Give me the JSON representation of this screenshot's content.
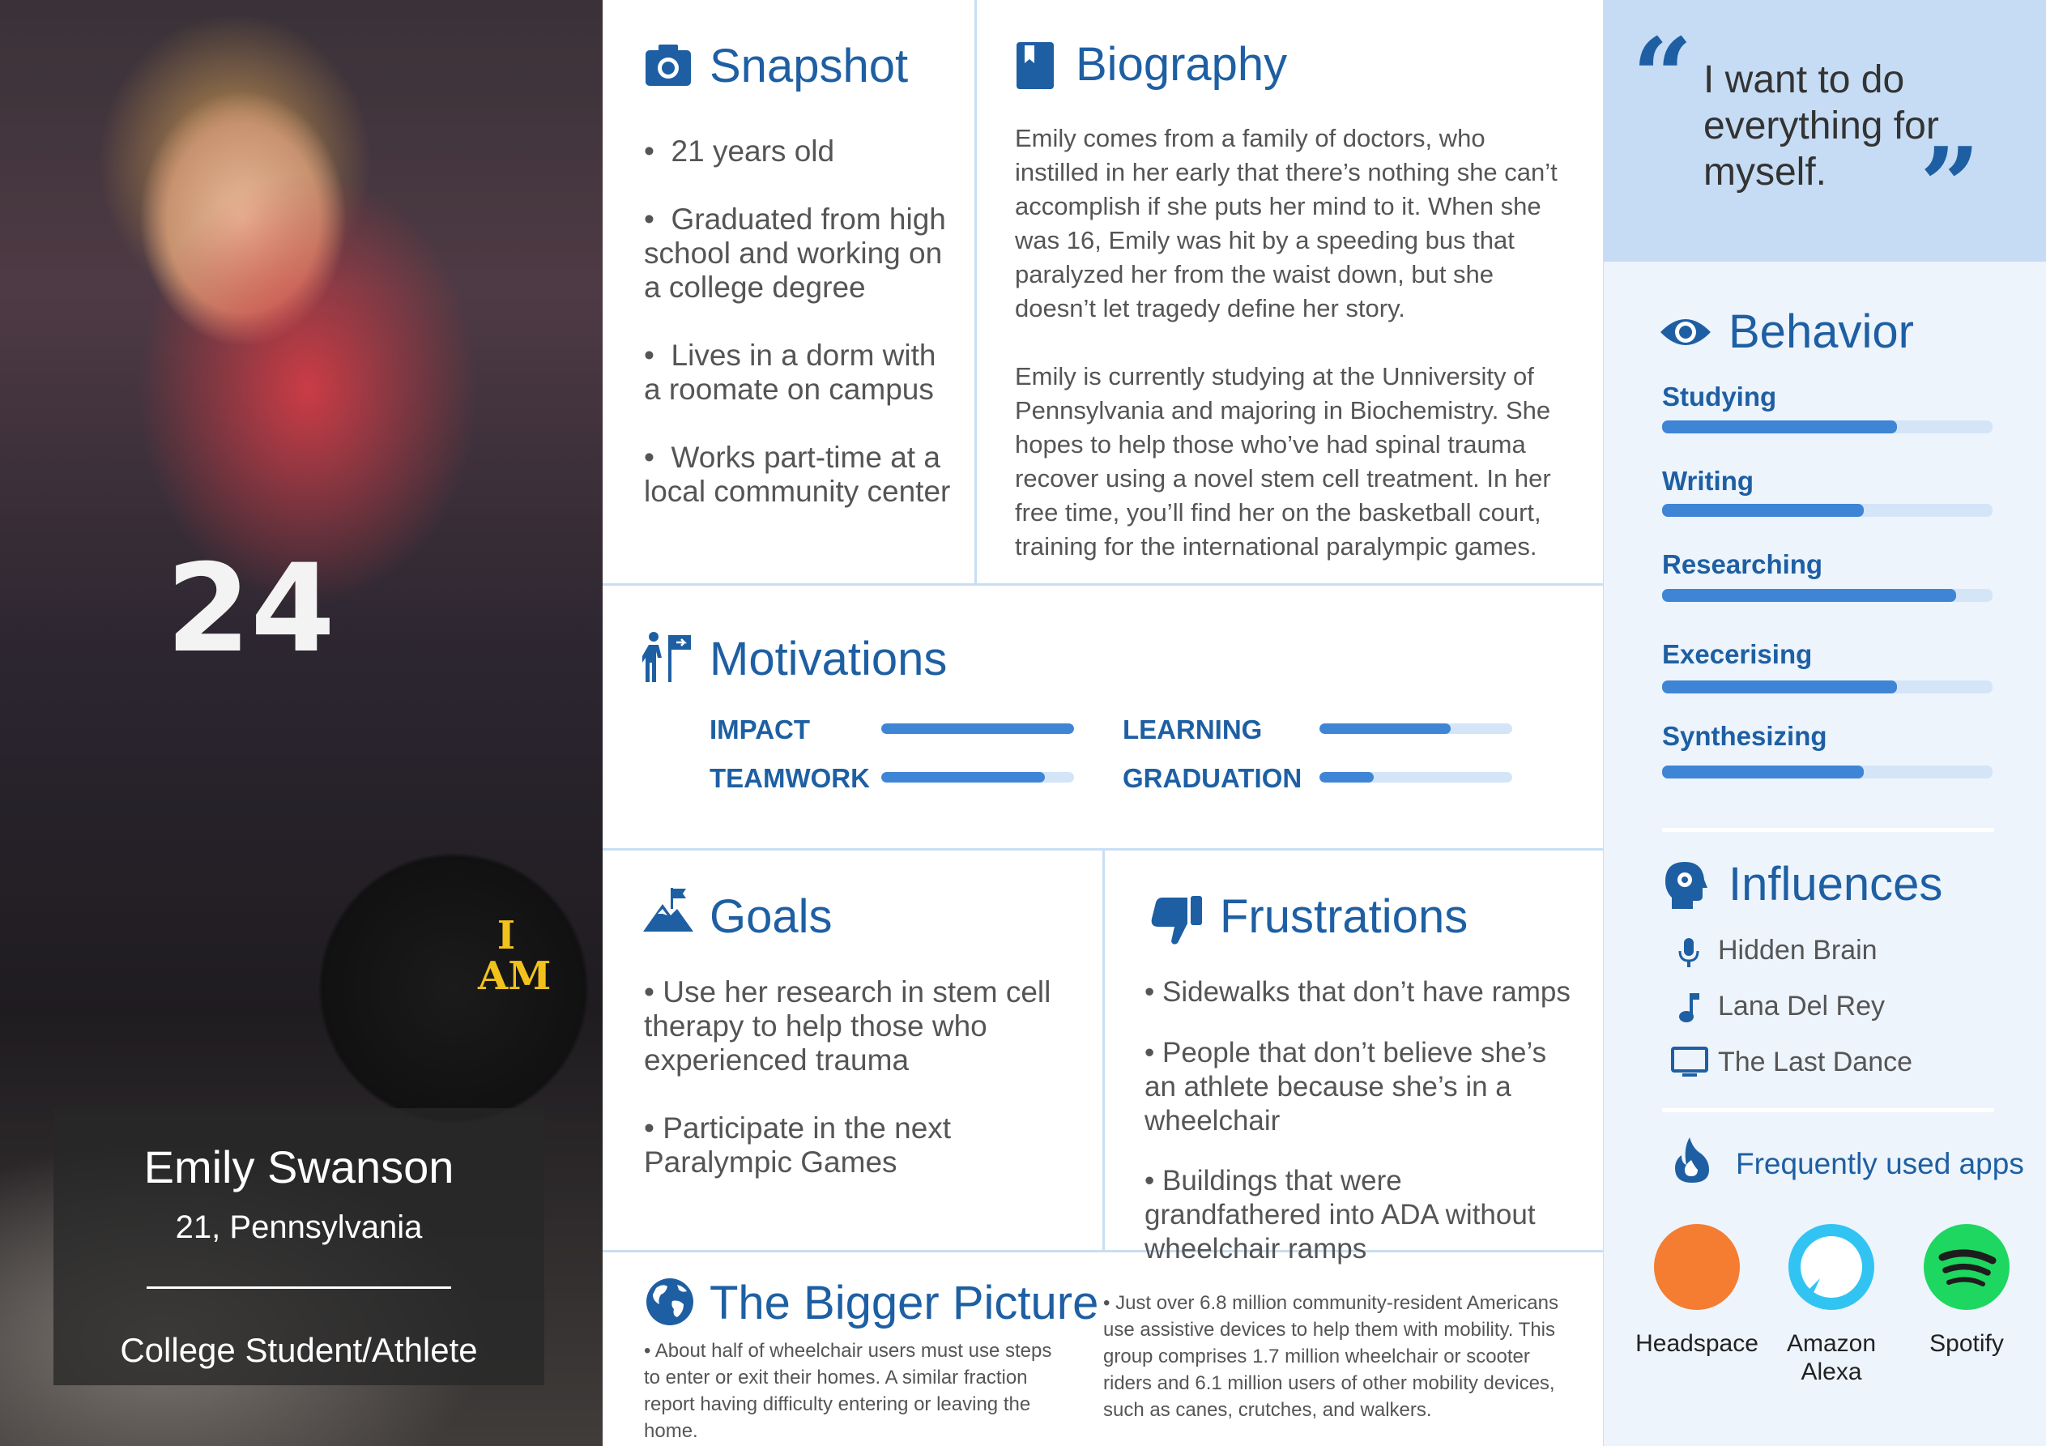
{
  "persona": {
    "name": "Emily Swanson",
    "location": "21, Pennsylvania",
    "role": "College Student/Athlete"
  },
  "snapshot": {
    "title": "Snapshot",
    "bullets": [
      "21 years old",
      "Graduated from high school and working on a college degree",
      "Lives in a dorm with a roomate on campus",
      "Works part-time at a local community center"
    ]
  },
  "biography": {
    "title": "Biography",
    "paragraphs": [
      "Emily comes from a family of doctors, who instilled in her early that there’s nothing she can’t accomplish if she puts her mind to it. When she was 16, Emily was hit by a speeding bus that paralyzed her from the waist down, but she doesn’t let tragedy define her story.",
      "Emily is currently studying at the Unniversity of Pennsylvania and majoring in Biochemistry. She hopes to help those who’ve had spinal trauma recover using a novel stem cell treatment. In her free time, you’ll find her on the basketball court, training for the international paralympic games."
    ]
  },
  "quote": {
    "text": "I want to do everything for myself.",
    "open_mark": "“",
    "close_mark": "”"
  },
  "motivations": {
    "title": "Motivations",
    "items": [
      {
        "label": "IMPACT",
        "level": 1.0
      },
      {
        "label": "LEARNING",
        "level": 0.68
      },
      {
        "label": "TEAMWORK",
        "level": 0.85
      },
      {
        "label": "GRADUATION",
        "level": 0.28
      }
    ]
  },
  "behavior": {
    "title": "Behavior",
    "items": [
      {
        "label": "Studying",
        "level": 0.71
      },
      {
        "label": "Writing",
        "level": 0.61
      },
      {
        "label": "Researching",
        "level": 0.89
      },
      {
        "label": "Execerising",
        "level": 0.71
      },
      {
        "label": "Synthesizing",
        "level": 0.61
      }
    ]
  },
  "goals": {
    "title": "Goals",
    "bullets": [
      "Use her research in stem cell therapy to help those who experienced trauma",
      "Participate in the next Paralympic Games"
    ]
  },
  "frustrations": {
    "title": "Frustrations",
    "bullets": [
      "Sidewalks that don’t have ramps",
      "People that don’t believe she’s an athlete because she’s in a wheelchair",
      "Buildings that were grandfathered into ADA without wheelchair ramps"
    ]
  },
  "influences": {
    "title": "Influences",
    "items": [
      {
        "label": "Hidden Brain",
        "icon": "microphone-icon"
      },
      {
        "label": "Lana Del Rey",
        "icon": "music-note-icon"
      },
      {
        "label": "The Last Dance",
        "icon": "tv-icon"
      }
    ]
  },
  "apps": {
    "title": "Frequently used apps",
    "items": [
      {
        "label": "Headspace",
        "color": "#f47d31",
        "icon": "headspace-icon"
      },
      {
        "label": "Amazon Alexa",
        "color": "#31c4f3",
        "icon": "alexa-icon"
      },
      {
        "label": "Spotify",
        "color": "#1ed760",
        "icon": "spotify-icon"
      }
    ]
  },
  "bigger_picture": {
    "title": "The Bigger Picture",
    "left": "• About half of wheelchair users must use steps to enter or exit their homes. A similar fraction report having difficulty entering or leaving the home.",
    "right": "• Just over 6.8 million community-resident Americans use assistive devices to help them with mobility. This group comprises 1.7 million wheelchair or scooter riders and 6.1 million users of other mobility devices, such as canes, crutches, and walkers."
  },
  "photo": {
    "jersey_number": "24",
    "wheel_text": "I AM"
  },
  "colors": {
    "accent": "#1e5fa3",
    "bar": "#3f85d6",
    "track": "#d3e5f7",
    "panel": "#edf4fc",
    "quote_bg": "#c5dcf4"
  }
}
